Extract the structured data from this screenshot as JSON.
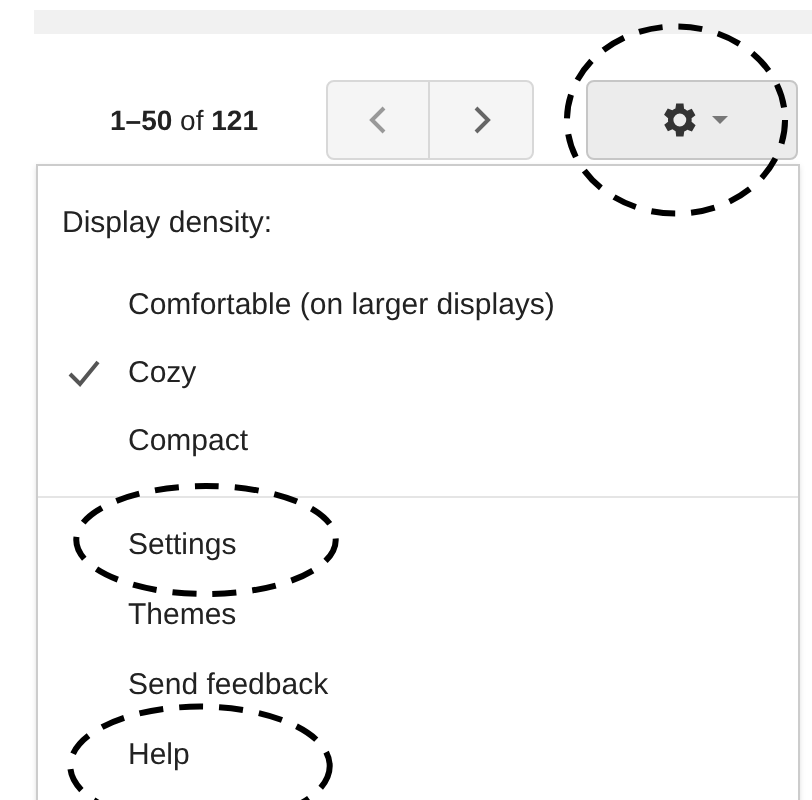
{
  "pager": {
    "range": "**1–50** of **121**"
  },
  "menu": {
    "items": [
      {
        "kind": "header",
        "label": "Display density:"
      },
      {
        "kind": "option",
        "label": "Comfortable (on larger displays)",
        "checked": false
      },
      {
        "kind": "option",
        "label": "Cozy",
        "checked": true
      },
      {
        "kind": "option",
        "label": "Compact",
        "checked": false
      },
      {
        "kind": "divider"
      },
      {
        "kind": "link",
        "label": "Settings"
      },
      {
        "kind": "link",
        "label": "Themes"
      },
      {
        "kind": "link",
        "label": "Send feedback"
      },
      {
        "kind": "link",
        "label": "Help"
      }
    ]
  }
}
